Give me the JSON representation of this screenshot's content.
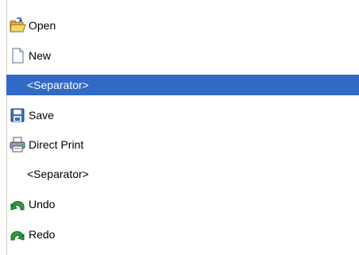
{
  "list": {
    "items": [
      {
        "label": "Open",
        "icon": "folder-open-icon",
        "selected": false,
        "separator": false
      },
      {
        "label": "New",
        "icon": "new-document-icon",
        "selected": false,
        "separator": false
      },
      {
        "label": "<Separator>",
        "icon": "",
        "selected": true,
        "separator": true
      },
      {
        "label": "Save",
        "icon": "floppy-disk-icon",
        "selected": false,
        "separator": false
      },
      {
        "label": "Direct Print",
        "icon": "printer-icon",
        "selected": false,
        "separator": false
      },
      {
        "label": "<Separator>",
        "icon": "",
        "selected": false,
        "separator": true
      },
      {
        "label": "Undo",
        "icon": "undo-arrow-icon",
        "selected": false,
        "separator": false
      },
      {
        "label": "Redo",
        "icon": "redo-arrow-icon",
        "selected": false,
        "separator": false
      }
    ]
  },
  "colors": {
    "selection": "#316ac5",
    "selection_text": "#ffffff",
    "text": "#000000",
    "background": "#ffffff"
  }
}
